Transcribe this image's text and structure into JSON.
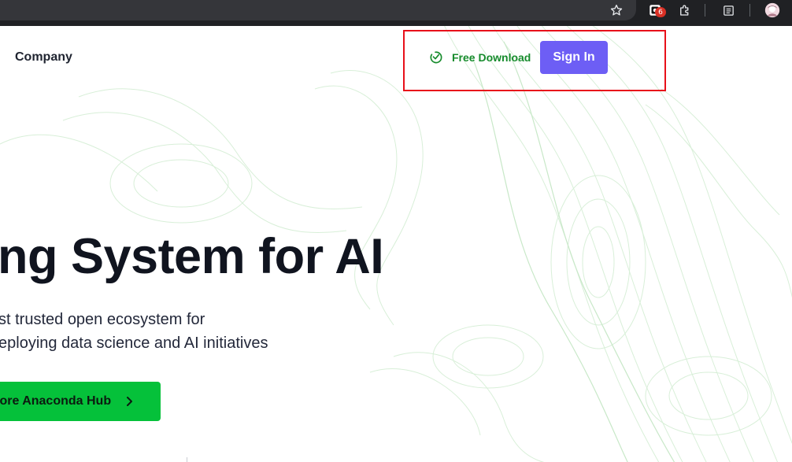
{
  "browser_toolbar": {
    "icons": [
      "star-icon",
      "extension-icon-with-badge",
      "puzzle-icon",
      "reading-list-icon",
      "profile-avatar"
    ],
    "extension_badge_count": "6",
    "badge_color": "#d93025"
  },
  "nav": {
    "company_label": "Company",
    "free_download_label": "Free Download",
    "sign_in_label": "Sign In"
  },
  "hero": {
    "title": "ng System for AI",
    "subtitle_line1": "st trusted open ecosystem for",
    "subtitle_line2": "eploying data science and AI initiatives",
    "cta_label": "lore Anaconda Hub"
  },
  "colors": {
    "brand_green": "#05c13a",
    "download_green": "#168b2c",
    "sign_in_purple": "#6d5ef5",
    "highlight_red": "#e8101a",
    "heading_dark": "#10141f"
  }
}
